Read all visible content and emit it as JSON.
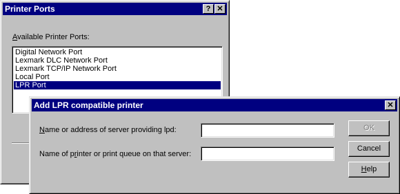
{
  "printer_ports": {
    "title": "Printer Ports",
    "help_btn": "?",
    "close_btn": "✕",
    "list_label_first": "A",
    "list_label_rest": "vailable Printer Ports:",
    "ports": [
      "Digital Network Port",
      "Lexmark DLC Network Port",
      "Lexmark TCP/IP Network Port",
      "Local Port",
      "LPR Port"
    ],
    "selected_index": 4
  },
  "lpr_dialog": {
    "title": "Add LPR compatible printer",
    "close_btn": "✕",
    "server_label_first": "N",
    "server_label_rest": "ame or address of server providing lpd:",
    "server_value": "",
    "queue_label_pre": "Name of p",
    "queue_label_u": "r",
    "queue_label_post": "inter or print queue on that server:",
    "queue_value": "",
    "ok_label": "OK",
    "cancel_label": "Cancel",
    "help_label_first": "H",
    "help_label_rest": "elp"
  }
}
